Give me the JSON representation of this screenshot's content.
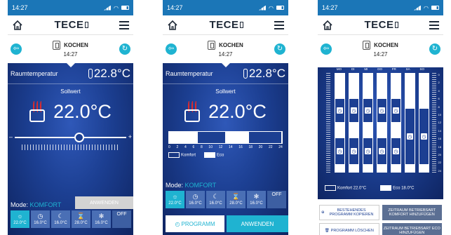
{
  "common": {
    "time": "14:27",
    "brand": "TECE",
    "room_name": "KOCHEN",
    "room_time": "14:27"
  },
  "screen1": {
    "room_temp_label": "Raumtemperatur",
    "room_temp_value": "22.8°C",
    "setpoint_label": "Sollwert",
    "setpoint_value": "22.0°C",
    "slider_minus": "–",
    "slider_plus": "+",
    "slider_level": 0.58,
    "mode_label": "Mode:",
    "mode_value": "KOMFORT",
    "modes": [
      {
        "icon": "☼",
        "temp": "22.0°C"
      },
      {
        "icon": "◷",
        "temp": "16.0°C"
      },
      {
        "icon": "☾",
        "temp": "16.0°C"
      },
      {
        "icon": "⌛",
        "temp": "28.0°C"
      },
      {
        "icon": "✻",
        "temp": "16.0°C"
      },
      {
        "icon": "",
        "temp": "OFF"
      }
    ],
    "apply": "ANWENDEN"
  },
  "screen2": {
    "room_temp_label": "Raumtemperatur",
    "room_temp_value": "22.8°C",
    "setpoint_label": "Sollwert",
    "setpoint_value": "22.0°C",
    "ticks": [
      "0",
      "2",
      "4",
      "6",
      "8",
      "10",
      "12",
      "14",
      "16",
      "18",
      "20",
      "22",
      "24"
    ],
    "legend_komfort": "Komfort",
    "legend_eco": "Eco",
    "mode_label": "Mode:",
    "mode_value": "KOMFORT",
    "modes": [
      {
        "icon": "☼",
        "temp": "22.0°C"
      },
      {
        "icon": "◷",
        "temp": "16.0°C"
      },
      {
        "icon": "☾",
        "temp": "16.0°C"
      },
      {
        "icon": "⌛",
        "temp": "28.0°C"
      },
      {
        "icon": "✻",
        "temp": "16.0°C"
      },
      {
        "icon": "",
        "temp": "OFF"
      }
    ],
    "program": "PROGRAMM",
    "apply": "ANWENDEN"
  },
  "screen3": {
    "days": [
      "MO",
      "DI",
      "MI",
      "DO",
      "FR",
      "SA",
      "SO"
    ],
    "ynums": [
      "0",
      "2",
      "4",
      "6",
      "8",
      "10",
      "12",
      "14",
      "16",
      "18",
      "20",
      "22",
      "24"
    ],
    "legend_komfort": "Komfort 22.0°C",
    "legend_eco": "Eco 18.0°C",
    "btn_copy": "BESTEHENDES PROGRAMM KOPIEREN",
    "btn_komfort": "ZEITRAUM BETRIEBSART KOMFORT HINZUFÜGEN",
    "btn_delete": "PROGRAMM LÖSCHEN",
    "btn_eco": "ZEITRAUM BETRIEBSART ECO HINZUFÜGEN"
  }
}
